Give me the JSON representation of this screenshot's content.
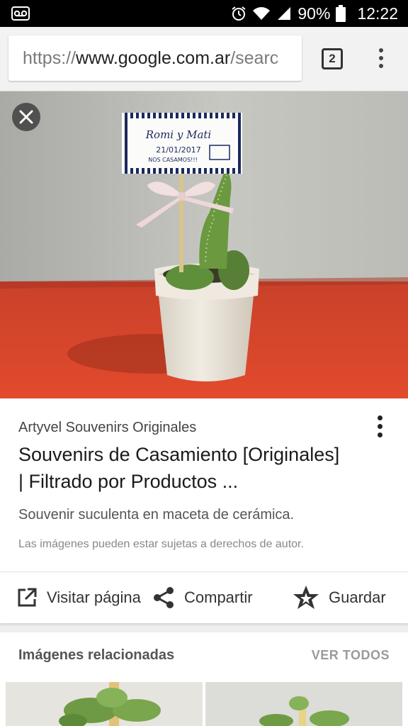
{
  "status_bar": {
    "battery": "90%",
    "time": "12:22",
    "icons": [
      "voicemail-icon",
      "alarm-icon",
      "wifi-icon",
      "signal-icon",
      "battery-icon"
    ]
  },
  "browser": {
    "url_scheme": "https://",
    "url_host": "www.google.com.ar",
    "url_path": "/searc",
    "tab_count": "2"
  },
  "photo": {
    "label_names": "Romi y Mati",
    "label_date": "21/01/2017",
    "label_text": "NOS CASAMOS!!!"
  },
  "result": {
    "source": "Artyvel Souvenirs Originales",
    "title_line1": "Souvenirs de Casamiento [Originales]",
    "title_line2": "| Filtrado por Productos ...",
    "description": "Souvenir suculenta en maceta de cerámica.",
    "rights": "Las imágenes pueden estar sujetas a derechos de autor."
  },
  "actions": {
    "visit": "Visitar página",
    "share": "Compartir",
    "save": "Guardar"
  },
  "related": {
    "title": "Imágenes relacionadas",
    "see_all": "VER TODOS"
  },
  "colors": {
    "status_bar": "#000000",
    "wall": "#bdbdb7",
    "table": "#d9402a",
    "pot": "#ece6dc",
    "cactus": "#5f8f3a"
  }
}
